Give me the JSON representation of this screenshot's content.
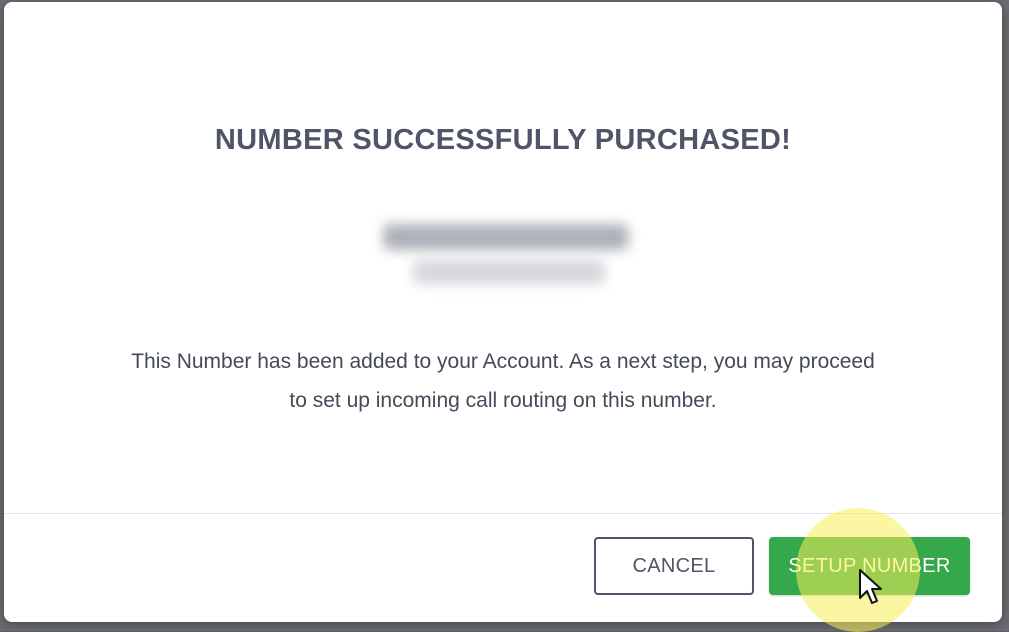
{
  "dialog": {
    "title": "NUMBER SUCCESSFULLY PURCHASED!",
    "message_line1": "This Number has been added to your Account. As a next step, you may proceed",
    "message_line2": "to set up incoming call routing on this number.",
    "cancel_label": "CANCEL",
    "setup_label": "SETUP NUMBER"
  },
  "colors": {
    "primary_button": "#34a84a",
    "title_text": "#4f5566",
    "cursor_highlight": "#f8ee5a"
  },
  "icons": {
    "cursor": "mouse-pointer-icon"
  }
}
